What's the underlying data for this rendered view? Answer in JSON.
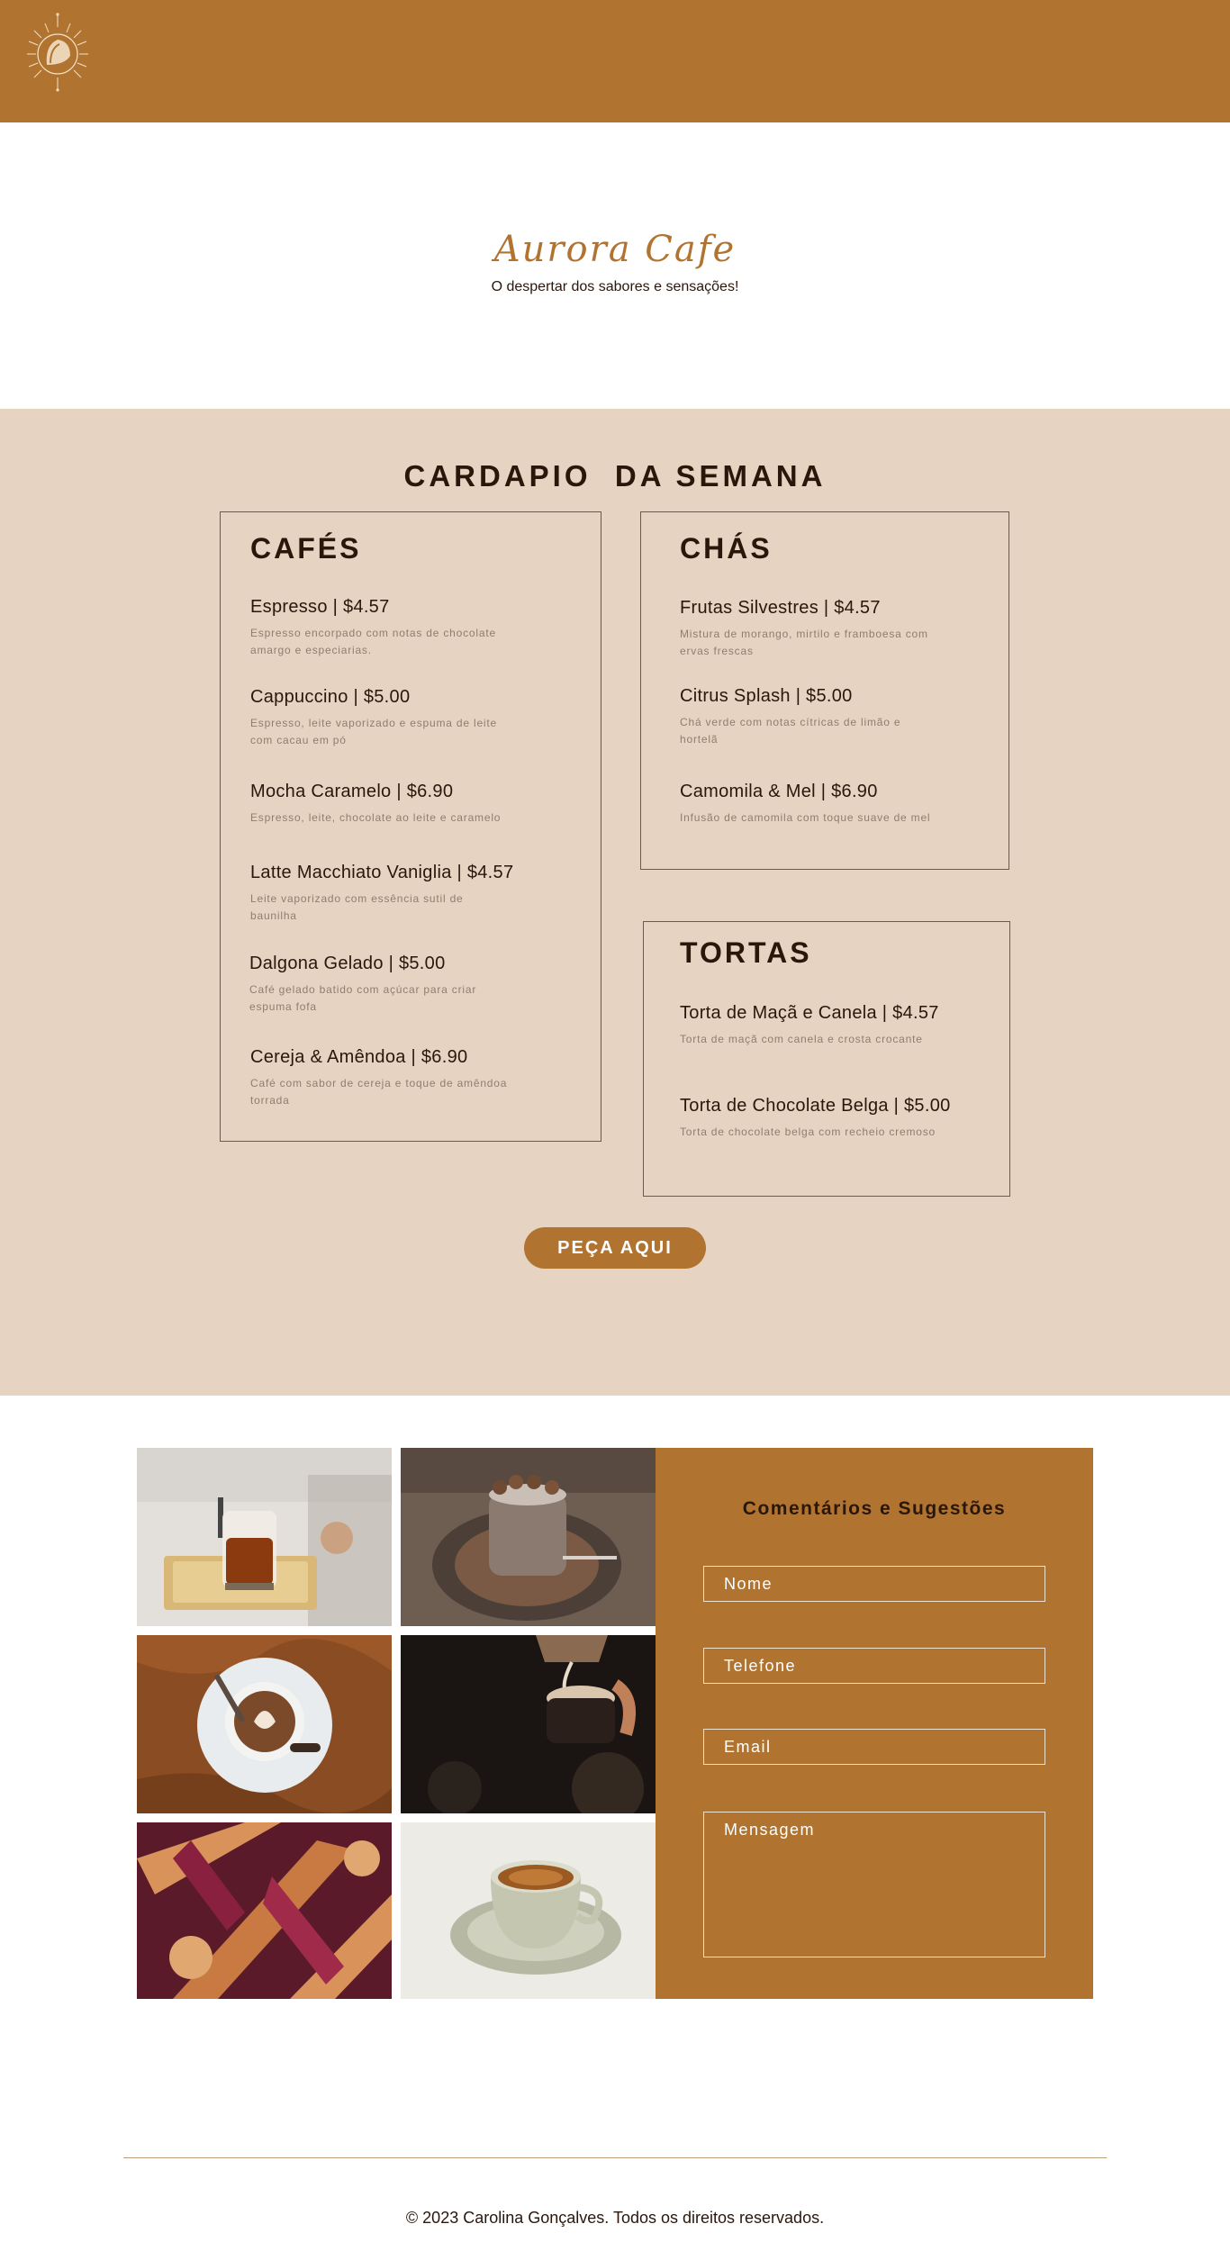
{
  "brand": {
    "name": "Aurora Cafe",
    "tagline": "O despertar dos sabores e sensações!"
  },
  "menu": {
    "title": "CARDAPIO  DA SEMANA",
    "order_button": "PEÇA AQUI",
    "categories": [
      {
        "title": "CAFÉS",
        "items": [
          {
            "name": "Espresso  |  $4.57",
            "desc": "Espresso encorpado com notas de chocolate amargo e especiarias."
          },
          {
            "name": "Cappuccino  |  $5.00",
            "desc": "Espresso, leite vaporizado e espuma de leite com cacau em pó"
          },
          {
            "name": "Mocha Caramelo |  $6.90",
            "desc": "Espresso, leite, chocolate ao leite e caramelo"
          },
          {
            "name": "Latte Macchiato Vaniglia |  $4.57",
            "desc": "Leite vaporizado com essência sutil de baunilha"
          },
          {
            "name": "Dalgona Gelado |  $5.00",
            "desc": "Café gelado batido com açúcar para criar espuma fofa"
          },
          {
            "name": "Cereja & Amêndoa  |  $6.90",
            "desc": "Café com sabor de cereja e toque de amêndoa torrada"
          }
        ]
      },
      {
        "title": "CHÁS",
        "items": [
          {
            "name": "Frutas Silvestres  |  $4.57",
            "desc": "Mistura de morango, mirtilo e framboesa com ervas frescas"
          },
          {
            "name": "Citrus Splash  |  $5.00",
            "desc": "Chá verde com notas cítricas de limão e hortelã"
          },
          {
            "name": "Camomila & Mel  |  $6.90",
            "desc": "Infusão de camomila com toque suave de mel"
          }
        ]
      },
      {
        "title": "TORTAS",
        "items": [
          {
            "name": "Torta de Maçã e Canela  |  $4.57",
            "desc": "Torta de maçã com canela e crosta crocante"
          },
          {
            "name": "Torta de Chocolate Belga  |  $5.00",
            "desc": "Torta de chocolate belga com recheio cremoso"
          }
        ]
      }
    ]
  },
  "feedback": {
    "title": "Comentários e Sugestões",
    "fields": {
      "name": "Nome",
      "phone": "Telefone",
      "email": "Email",
      "message": "Mensagem"
    }
  },
  "footer": {
    "text": "© 2023 Carolina Gonçalves. Todos os direitos reservados."
  },
  "colors": {
    "header": "#b07430",
    "menu_bg": "#e6d3c1",
    "text_dark": "#2a170c",
    "desc_text": "#8f7d70"
  }
}
